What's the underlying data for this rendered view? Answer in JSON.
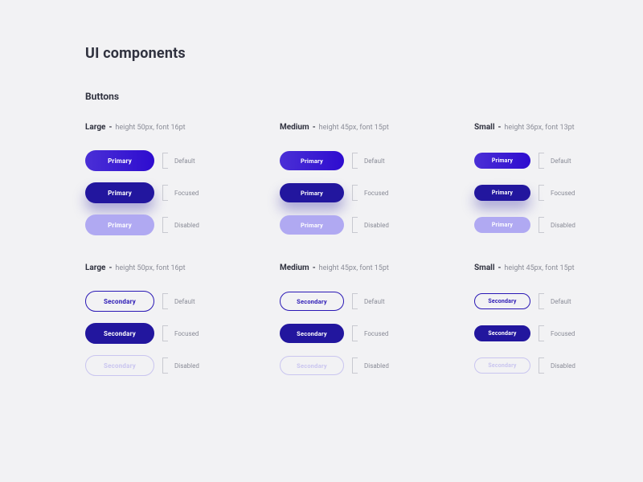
{
  "page_title": "UI components",
  "section_title": "Buttons",
  "primary_label": "Primary",
  "secondary_label": "Secondary",
  "states": {
    "default": "Default",
    "focused": "Focused",
    "disabled": "Disabled"
  },
  "sizes_primary": {
    "large": {
      "name": "Large",
      "dash": " -",
      "spec": "height 50px, font 16pt"
    },
    "medium": {
      "name": "Medium",
      "dash": " -",
      "spec": "height 45px, font 15pt"
    },
    "small": {
      "name": "Small",
      "dash": " -",
      "spec": "height 36px, font 13pt"
    }
  },
  "sizes_secondary": {
    "large": {
      "name": "Large",
      "dash": " -",
      "spec": "height 50px, font 16pt"
    },
    "medium": {
      "name": "Medium",
      "dash": " -",
      "spec": "height 45px, font 15pt"
    },
    "small": {
      "name": "Small",
      "dash": " -",
      "spec": "height 45px, font 15pt"
    }
  }
}
